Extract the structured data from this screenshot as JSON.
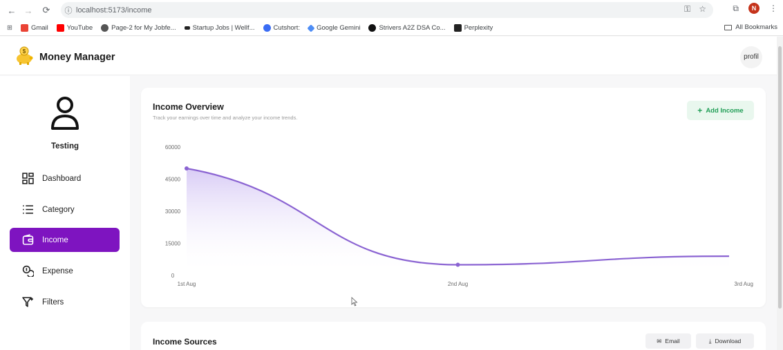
{
  "browser": {
    "url_host": "localhost:5173",
    "url_path": "/income",
    "profile_initial": "N",
    "bookmarks": [
      "Gmail",
      "YouTube",
      "Page-2 for My Jobfe...",
      "Startup Jobs | Wellf...",
      "Cutshort:",
      "Google Gemini",
      "Strivers A2Z DSA Co...",
      "Perplexity"
    ],
    "all_bookmarks": "All Bookmarks"
  },
  "app": {
    "title": "Money Manager",
    "profile_alt": "profil"
  },
  "sidebar": {
    "user_name": "Testing",
    "items": [
      {
        "label": "Dashboard",
        "icon": "dashboard-icon",
        "active": false
      },
      {
        "label": "Category",
        "icon": "list-icon",
        "active": false
      },
      {
        "label": "Income",
        "icon": "wallet-icon",
        "active": true
      },
      {
        "label": "Expense",
        "icon": "coins-icon",
        "active": false
      },
      {
        "label": "Filters",
        "icon": "filter-icon",
        "active": false
      }
    ]
  },
  "income_overview": {
    "title": "Income Overview",
    "subtitle": "Track your earnings over time and analyze your income trends.",
    "add_button": "Add Income"
  },
  "income_sources": {
    "title": "Income Sources",
    "email_button": "Email",
    "download_button": "Download"
  },
  "colors": {
    "accent": "#7e14c0",
    "line": "#8a63d2",
    "add_button_text": "#1f9d55"
  },
  "chart_data": {
    "type": "area",
    "categories": [
      "1st Aug",
      "2nd Aug",
      "3rd Aug"
    ],
    "values": [
      50000,
      5000,
      9000
    ],
    "ylim": [
      0,
      60000
    ],
    "yticks": [
      0,
      15000,
      30000,
      45000,
      60000
    ],
    "grid": false,
    "title": "",
    "xlabel": "",
    "ylabel": ""
  }
}
